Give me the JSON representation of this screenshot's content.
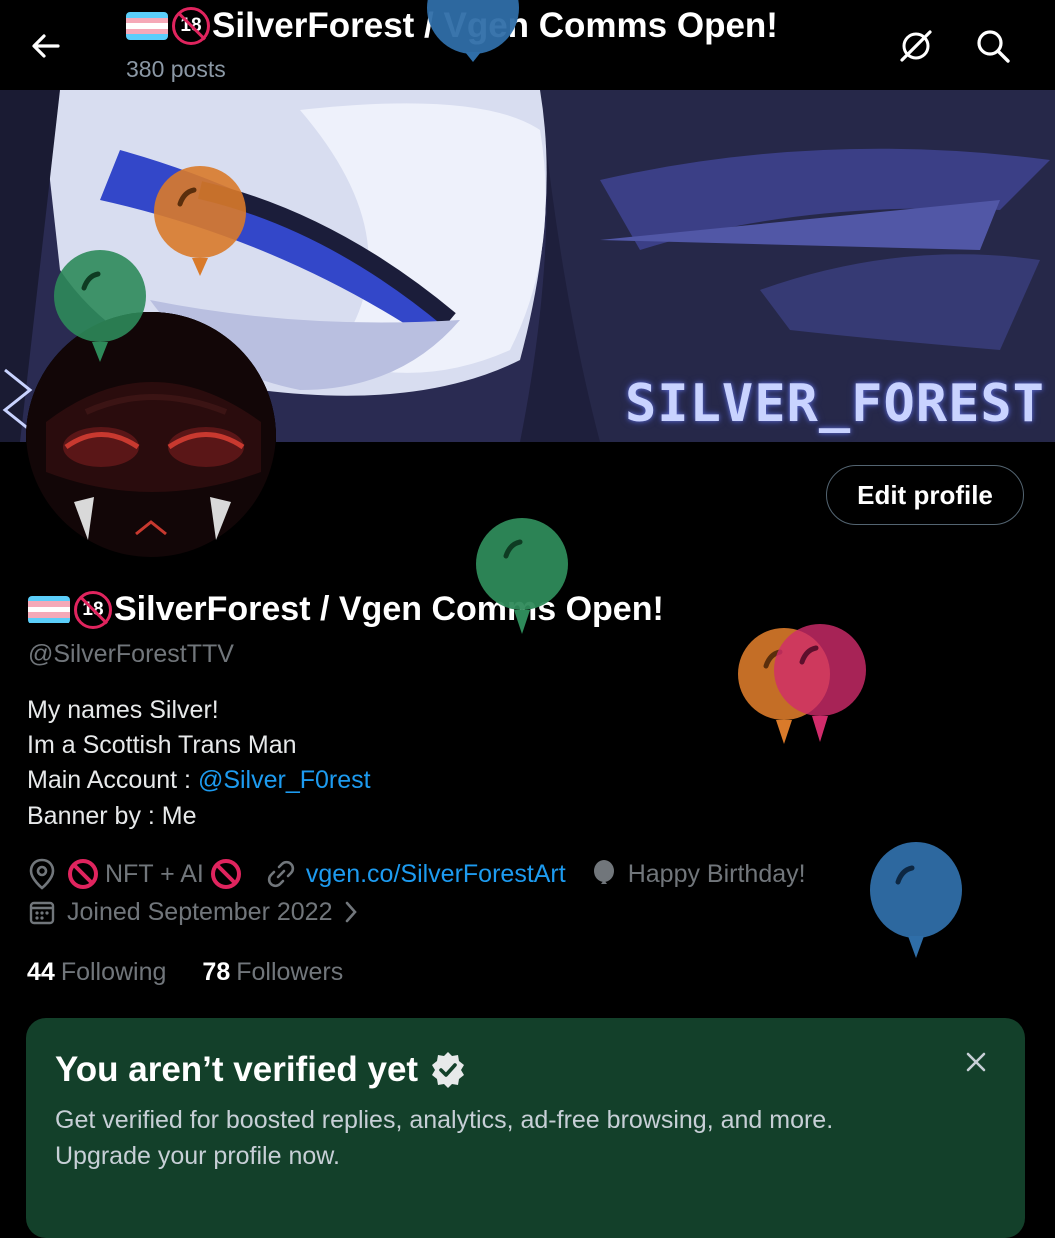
{
  "header": {
    "title": "SilverForest / Vgen Comms Open!",
    "age_badge": "18",
    "posts": "380 posts",
    "icons": {
      "back": "back-arrow-icon",
      "grok": "grok-icon",
      "search": "search-icon"
    }
  },
  "banner": {
    "text": "SILVER_FOREST"
  },
  "profile": {
    "edit_label": "Edit profile",
    "display_name": "SilverForest / Vgen Comms Open!",
    "age_badge": "18",
    "handle": "@SilverForestTTV",
    "bio": {
      "line1": "My names Silver!",
      "line2": "Im a Scottish Trans Man",
      "line3_prefix": "Main Account : ",
      "line3_link": "@Silver_F0rest",
      "line4": "Banner by : Me"
    },
    "location": "NFT + AI",
    "website": "vgen.co/SilverForestArt",
    "birthday": "Happy Birthday!",
    "joined": "Joined September 2022",
    "following_count": "44",
    "following_label": "Following",
    "followers_count": "78",
    "followers_label": "Followers"
  },
  "verify_card": {
    "title": "You aren’t verified yet",
    "desc_line1": "Get verified for boosted replies, analytics, ad-free browsing, and more.",
    "desc_line2": "Upgrade your profile now."
  },
  "colors": {
    "accent_link": "#1d9bf0",
    "muted_text": "#71767b",
    "verify_card_bg": "#13402a",
    "prohibited_red": "#e0245e",
    "balloon_blue": "#2f6ea8",
    "balloon_green": "#2e8a5a",
    "balloon_orange": "#d97a2a",
    "balloon_pink": "#d12c6b"
  }
}
